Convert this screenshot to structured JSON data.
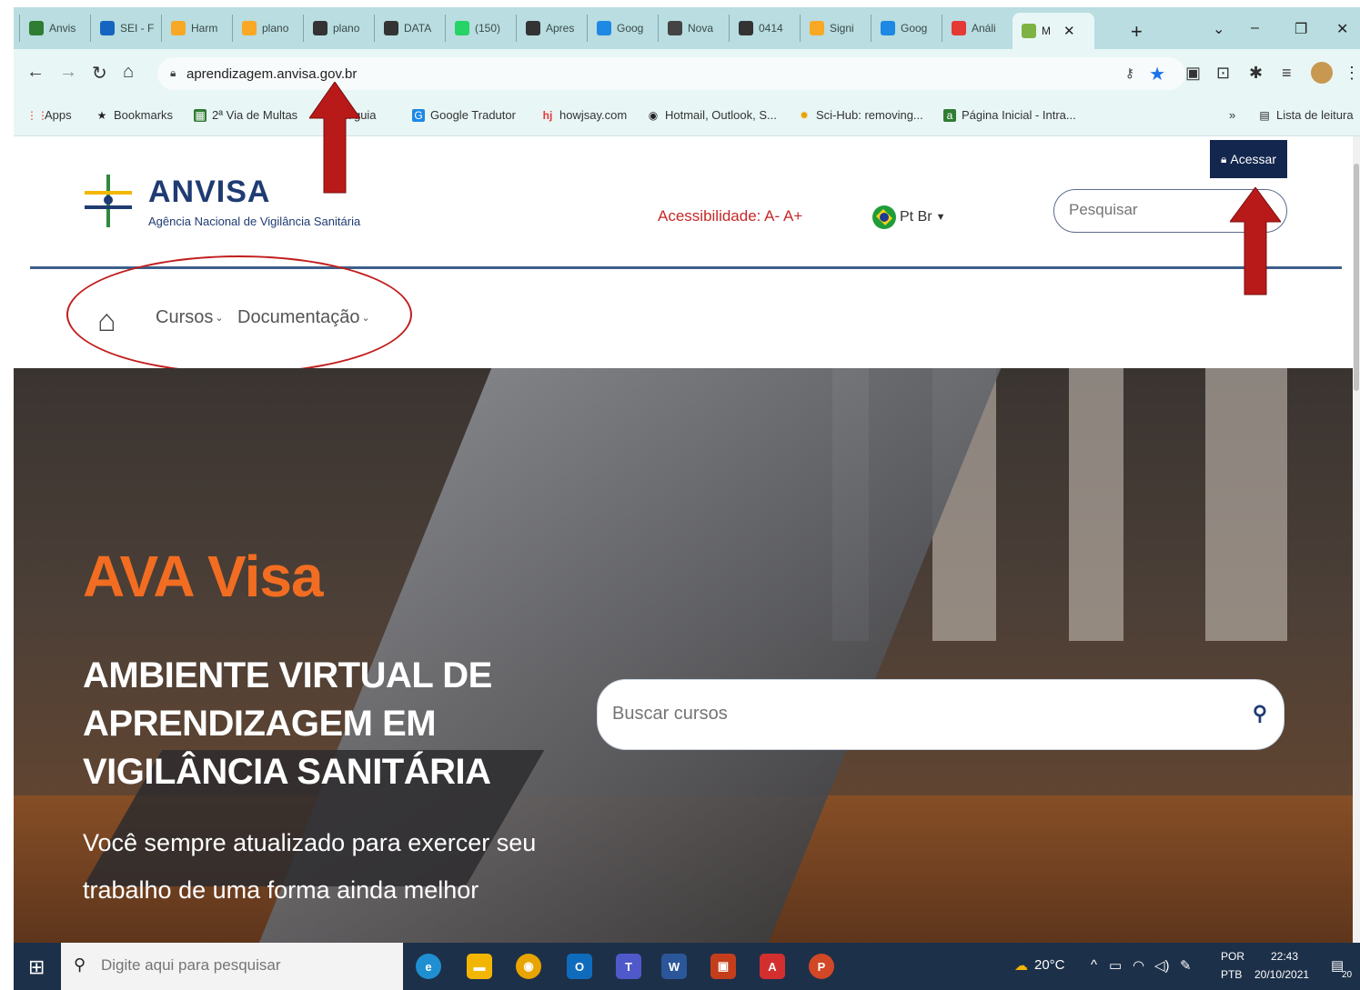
{
  "browser": {
    "tabs": [
      {
        "label": "Anvis",
        "icon": "anvisa-icon",
        "color": "#2e7d32"
      },
      {
        "label": "SEI - F",
        "icon": "sei-icon",
        "color": "#1565c0"
      },
      {
        "label": "Harm",
        "icon": "harm-icon",
        "color": "#f9a825"
      },
      {
        "label": "plano",
        "icon": "plano-icon",
        "color": "#f9a825"
      },
      {
        "label": "plano",
        "icon": "globe-icon",
        "color": "#333333"
      },
      {
        "label": "DATA",
        "icon": "globe-icon",
        "color": "#333333"
      },
      {
        "label": "(150)",
        "icon": "whatsapp-icon",
        "color": "#25d366"
      },
      {
        "label": "Apres",
        "icon": "globe-icon",
        "color": "#333333"
      },
      {
        "label": "Goog",
        "icon": "google-slides-icon",
        "color": "#1e88e5"
      },
      {
        "label": "Nova",
        "icon": "nova-icon",
        "color": "#444444"
      },
      {
        "label": "0414",
        "icon": "globe-icon",
        "color": "#333333"
      },
      {
        "label": "Signi",
        "icon": "signi-icon",
        "color": "#f9a825"
      },
      {
        "label": "Goog",
        "icon": "google-translate-icon",
        "color": "#1e88e5"
      },
      {
        "label": "Análi",
        "icon": "youtube-icon",
        "color": "#e53935"
      },
      {
        "label": "M",
        "icon": "anvisa-logo-icon",
        "color": "#7cb342",
        "active": true
      }
    ],
    "url": "aprendizagem.anvisa.gov.br",
    "bookmarks": [
      {
        "label": "Apps",
        "icon": "apps-grid-icon"
      },
      {
        "label": "Bookmarks",
        "icon": "star-icon"
      },
      {
        "label": "2ª Via de Multas",
        "icon": "green-square-icon"
      },
      {
        "label": "Nova guia",
        "icon": "nova-icon"
      },
      {
        "label": "Google Tradutor",
        "icon": "google-translate-icon"
      },
      {
        "label": "howjsay.com",
        "icon": "hj-icon"
      },
      {
        "label": "Hotmail, Outlook, S...",
        "icon": "globe-icon"
      },
      {
        "label": "Sci-Hub: removing...",
        "icon": "scihub-icon"
      },
      {
        "label": "Página Inicial - Intra...",
        "icon": "anvisa-icon"
      }
    ],
    "reading_list": "Lista de leitura",
    "overflow": "»"
  },
  "site": {
    "logo_title": "ANVISA",
    "logo_subtitle": "Agência Nacional de Vigilância Sanitária",
    "accessibility": "Acessibilidade:  A-  A+",
    "language": "Pt Br",
    "login_label": "Acessar",
    "search_placeholder": "Pesquisar",
    "menu": {
      "courses": "Cursos",
      "documentation": "Documentação"
    },
    "hero": {
      "title": "AVA Visa",
      "subtitle": "AMBIENTE VIRTUAL DE APRENDIZAGEM EM VIGILÂNCIA SANITÁRIA",
      "description": "Você sempre atualizado para exercer seu trabalho de uma forma ainda melhor",
      "search_placeholder": "Buscar cursos"
    },
    "colors": {
      "brand_navy": "#1f3b72",
      "hero_orange": "#f26d21",
      "accent_red": "#c62828",
      "annotation_red": "#b81a1a"
    }
  },
  "taskbar": {
    "search_placeholder": "Digite aqui para pesquisar",
    "weather": "20°C",
    "lang_top": "POR",
    "lang_bottom": "PTB",
    "time": "22:43",
    "date": "20/10/2021",
    "notifications": "20"
  }
}
